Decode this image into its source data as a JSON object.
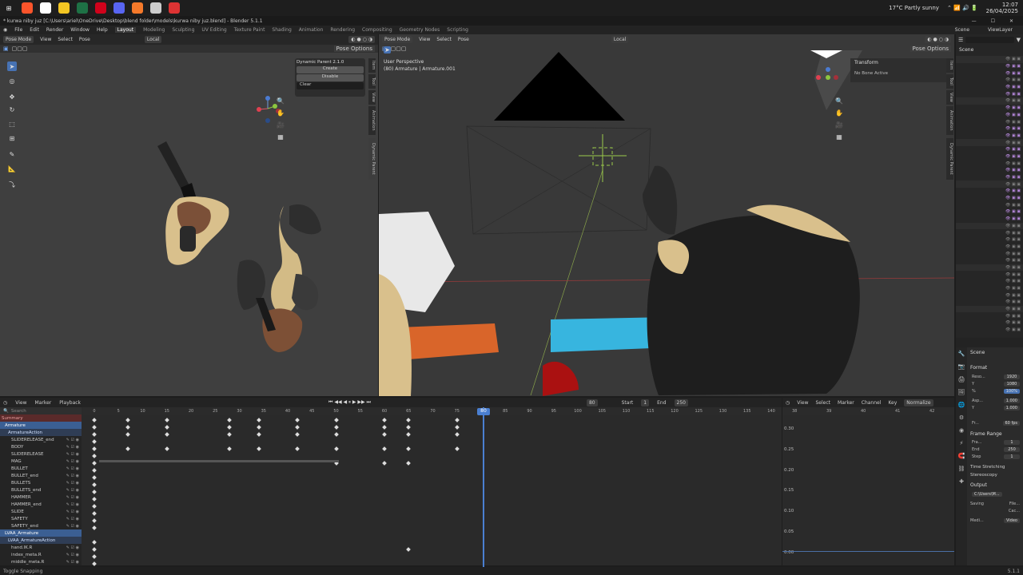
{
  "taskbar": {
    "apps": [
      {
        "icon": "windows-icon",
        "color": "#ffffff"
      },
      {
        "icon": "brave-icon",
        "color": "#fb542b"
      },
      {
        "icon": "tiktok-icon",
        "color": "#ffffff"
      },
      {
        "icon": "files-icon",
        "color": "#f3c623"
      },
      {
        "icon": "excel-icon",
        "color": "#1e7145"
      },
      {
        "icon": "opera-icon",
        "color": "#d0021b"
      },
      {
        "icon": "discord-icon",
        "color": "#5865f2"
      },
      {
        "icon": "blender-icon",
        "color": "#f5792a"
      },
      {
        "icon": "app-icon",
        "color": "#cccccc"
      },
      {
        "icon": "davinci-icon",
        "color": "#dd3333"
      }
    ],
    "weather": "17°C  Partly sunny",
    "time": "12:07",
    "date": "26/04/2025"
  },
  "window": {
    "title": "* kurwa niby juz [C:\\Users\\ariel\\OneDrive\\Desktop\\blend folder\\models\\kurwa niby juz.blend] - Blender 5.1.1"
  },
  "menu": {
    "items": [
      "File",
      "Edit",
      "Render",
      "Window",
      "Help"
    ],
    "workspaces": [
      "Layout",
      "Modeling",
      "Sculpting",
      "UV Editing",
      "Texture Paint",
      "Shading",
      "Animation",
      "Rendering",
      "Compositing",
      "Geometry Nodes",
      "Scripting"
    ],
    "active_workspace": "Layout",
    "scene": "Scene",
    "view_layer": "ViewLayer"
  },
  "left_viewport": {
    "mode": "Pose Mode",
    "menus": [
      "View",
      "Select",
      "Pose"
    ],
    "orientation": "Local",
    "pose_options": "Pose Options",
    "panel_title": "Dynamic Parent 2.1.0",
    "buttons": [
      "Create",
      "Disable"
    ],
    "clear": "Clear",
    "tabs": [
      "Item",
      "Tool",
      "View",
      "Animation",
      "Dynamic Parent"
    ]
  },
  "right_viewport": {
    "mode": "Pose Mode",
    "menus": [
      "View",
      "Select",
      "Pose"
    ],
    "orientation": "Local",
    "pose_options": "Pose Options",
    "view_name": "User Perspective",
    "object_info": "(80) Armature | Armature.001",
    "transform_title": "Transform",
    "no_bone": "No Bone Active",
    "tabs": [
      "Item",
      "Tool",
      "View",
      "Animation",
      "Dynamic Parent"
    ]
  },
  "dopesheet": {
    "menus": [
      "View",
      "Marker",
      "Playback"
    ],
    "current_frame": "80",
    "start_label": "Start",
    "start": "1",
    "end_label": "End",
    "end": "250",
    "search_placeholder": "Search",
    "channels": [
      {
        "label": "Summary",
        "color": "#e8a0a0",
        "bg": "#5a2a2a",
        "indent": 0
      },
      {
        "label": "Armature",
        "color": "#ffffff",
        "bg": "#3b5f93",
        "indent": 1
      },
      {
        "label": "ArmatureAction",
        "color": "#cfe0ff",
        "bg": "#2f3d55",
        "indent": 2
      },
      {
        "label": "SLIDERELEASE_end",
        "color": "#cccccc",
        "bg": "",
        "indent": 3
      },
      {
        "label": "BODY",
        "color": "#cccccc",
        "bg": "",
        "indent": 3
      },
      {
        "label": "SLIDERELEASE",
        "color": "#cccccc",
        "bg": "",
        "indent": 3
      },
      {
        "label": "MAG",
        "color": "#cccccc",
        "bg": "",
        "indent": 3
      },
      {
        "label": "BULLET",
        "color": "#cccccc",
        "bg": "",
        "indent": 3
      },
      {
        "label": "BULLET_end",
        "color": "#cccccc",
        "bg": "",
        "indent": 3
      },
      {
        "label": "BULLETS",
        "color": "#cccccc",
        "bg": "",
        "indent": 3
      },
      {
        "label": "BULLETS_end",
        "color": "#cccccc",
        "bg": "",
        "indent": 3
      },
      {
        "label": "HAMMER",
        "color": "#cccccc",
        "bg": "",
        "indent": 3
      },
      {
        "label": "HAMMER_end",
        "color": "#cccccc",
        "bg": "",
        "indent": 3
      },
      {
        "label": "SLIDE",
        "color": "#cccccc",
        "bg": "",
        "indent": 3
      },
      {
        "label": "SAFETY",
        "color": "#cccccc",
        "bg": "",
        "indent": 3
      },
      {
        "label": "SAFETY_end",
        "color": "#cccccc",
        "bg": "",
        "indent": 3
      },
      {
        "label": "LVAA_Armature",
        "color": "#ffffff",
        "bg": "#3b5f93",
        "indent": 1
      },
      {
        "label": "LVAA_ArmatureAction",
        "color": "#cfe0ff",
        "bg": "#2f3d55",
        "indent": 2
      },
      {
        "label": "hand.IK.R",
        "color": "#cccccc",
        "bg": "",
        "indent": 3
      },
      {
        "label": "index_meta.R",
        "color": "#cccccc",
        "bg": "",
        "indent": 3
      },
      {
        "label": "middle_meta.R",
        "color": "#cccccc",
        "bg": "",
        "indent": 3
      }
    ],
    "ruler": [
      "0",
      "5",
      "10",
      "15",
      "20",
      "25",
      "30",
      "35",
      "40",
      "45",
      "50",
      "55",
      "60",
      "65",
      "70",
      "75",
      "80",
      "85",
      "90",
      "95",
      "100",
      "105",
      "110",
      "115",
      "120",
      "125",
      "130",
      "135",
      "140"
    ],
    "keyframes": [
      {
        "row": 0,
        "frames": [
          0,
          7,
          15,
          28,
          34,
          42,
          50,
          60,
          65,
          75
        ]
      },
      {
        "row": 1,
        "frames": [
          0,
          7,
          15,
          28,
          34,
          42,
          50,
          60,
          65,
          75
        ]
      },
      {
        "row": 2,
        "frames": [
          0,
          7,
          15,
          28,
          34,
          42,
          50,
          60,
          65,
          75
        ]
      },
      {
        "row": 3,
        "frames": [
          0
        ]
      },
      {
        "row": 4,
        "frames": [
          0,
          7,
          15,
          28,
          34,
          42,
          50,
          60,
          65,
          75
        ]
      },
      {
        "row": 5,
        "frames": [
          0
        ]
      },
      {
        "row": 6,
        "frames": [
          0,
          50,
          60,
          65
        ]
      },
      {
        "row": 7,
        "frames": [
          0
        ]
      },
      {
        "row": 8,
        "frames": [
          0
        ]
      },
      {
        "row": 9,
        "frames": [
          0
        ]
      },
      {
        "row": 10,
        "frames": [
          0
        ]
      },
      {
        "row": 11,
        "frames": [
          0
        ]
      },
      {
        "row": 12,
        "frames": [
          0
        ]
      },
      {
        "row": 13,
        "frames": [
          0
        ]
      },
      {
        "row": 14,
        "frames": [
          0
        ]
      },
      {
        "row": 15,
        "frames": [
          0
        ]
      },
      {
        "row": 17,
        "frames": [
          0
        ]
      },
      {
        "row": 18,
        "frames": [
          0,
          65
        ]
      },
      {
        "row": 19,
        "frames": [
          0
        ]
      },
      {
        "row": 20,
        "frames": [
          0
        ]
      }
    ]
  },
  "graph": {
    "menus": [
      "View",
      "Select",
      "Marker",
      "Channel",
      "Key"
    ],
    "normalize": "Normalize",
    "y_labels": [
      "0.30",
      "0.25",
      "0.20",
      "0.15",
      "0.10",
      "0.05",
      "0.00"
    ],
    "ruler": [
      "38",
      "39",
      "40",
      "41",
      "42"
    ]
  },
  "properties": {
    "scene": "Scene",
    "format": "Format",
    "res_x": "1920",
    "res_y": "1080",
    "res_pct": "100%",
    "aspect_x": "1.000",
    "aspect_y": "1.000",
    "fps": "60 fps",
    "frame_range": "Frame Range",
    "frame_start": "1",
    "frame_end": "250",
    "step": "1",
    "time_stretching": "Time Stretching",
    "stereoscopy": "Stereoscopy",
    "output": "Output",
    "output_path": "C:\\Users\\M...",
    "saving": "Saving",
    "file_ext": "File...",
    "cache": "Cac...",
    "media": "Medi...",
    "video": "Video"
  },
  "status": {
    "hint": "Toggle Snapping",
    "version": "5.1.1"
  }
}
